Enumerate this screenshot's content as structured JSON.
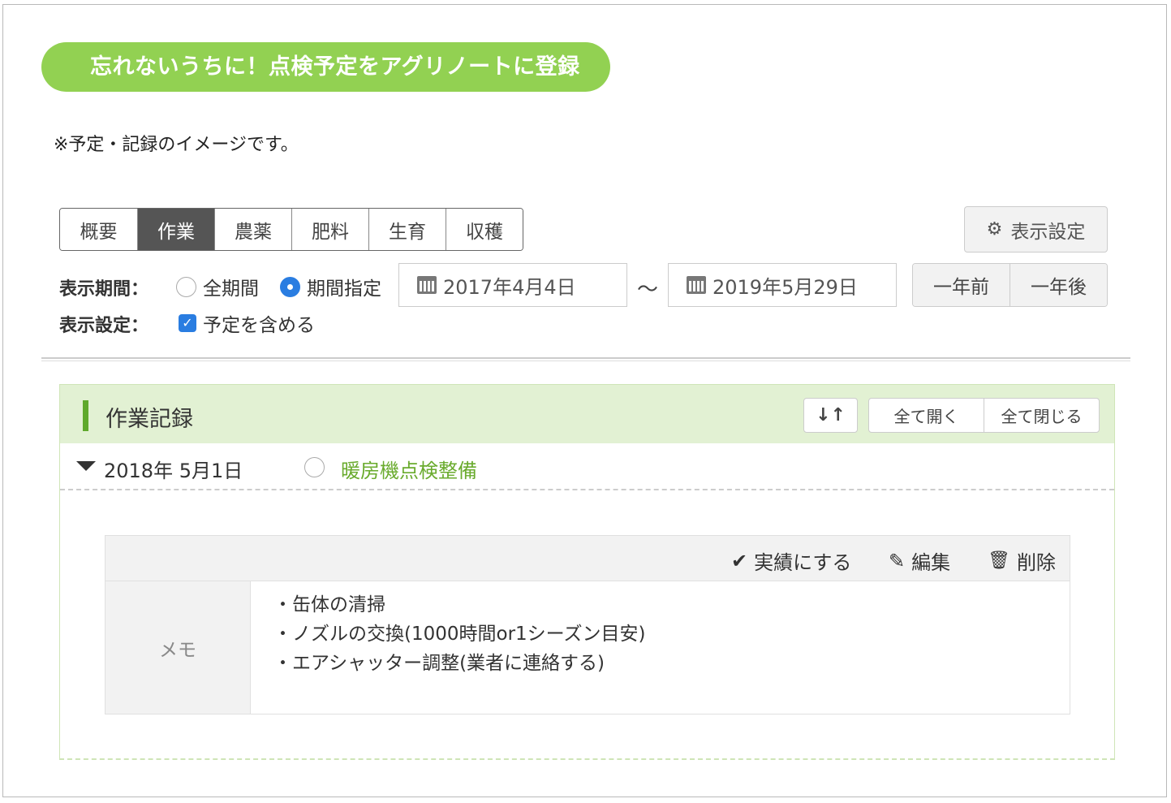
{
  "banner": "忘れないうちに！点検予定をアグリノートに登録",
  "note": "※予定・記録のイメージです。",
  "tabs": [
    "概要",
    "作業",
    "農薬",
    "肥料",
    "生育",
    "収穫"
  ],
  "active_tab": "作業",
  "settings_button": "表示設定",
  "filters": {
    "period_label": "表示期間：",
    "period_all": "全期間",
    "period_custom": "期間指定",
    "date_from": "2017年4月4日",
    "tilde": "～",
    "date_to": "2019年5月29日",
    "prev_year": "一年前",
    "next_year": "一年後",
    "display_label": "表示設定：",
    "include_plans": "予定を含める"
  },
  "records": {
    "title": "作業記録",
    "sort_icon": "↓↑",
    "expand_all": "全て開く",
    "collapse_all": "全て閉じる",
    "entry": {
      "date": "2018年  5月1日",
      "name": "暖房機点検整備"
    },
    "actions": {
      "complete": "実績にする",
      "edit": "編集",
      "delete": "削除"
    },
    "memo_label": "メモ",
    "memo_lines": [
      "・缶体の清掃",
      "・ノズルの交換(1000時間or1シーズン目安)",
      "・エアシャッター調整(業者に連絡する)"
    ]
  },
  "colors": {
    "banner": "#92d152",
    "accent_green": "#6aab2e",
    "header_bg": "#e2f1d3",
    "active_tab": "#555555",
    "radio_on": "#2a7de1"
  }
}
